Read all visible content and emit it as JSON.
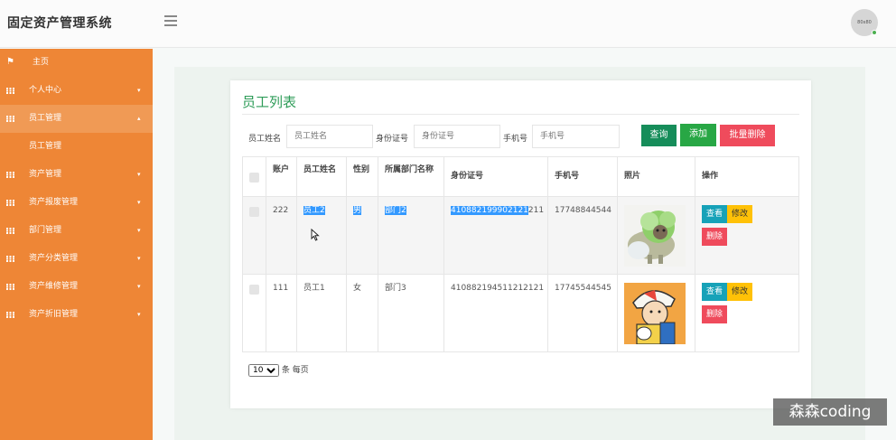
{
  "header": {
    "app_title": "固定资产管理系统",
    "avatar_text": "80x80"
  },
  "sidebar": {
    "items": [
      {
        "label": "主页",
        "icon": "flag-icon",
        "expanded": false
      },
      {
        "label": "个人中心",
        "icon": "grid-icon",
        "caret": "▾"
      },
      {
        "label": "员工管理",
        "icon": "grid-icon",
        "caret": "▴",
        "active": true
      },
      {
        "label": "资产管理",
        "icon": "grid-icon",
        "caret": "▾"
      },
      {
        "label": "资产报废管理",
        "icon": "grid-icon",
        "caret": "▾"
      },
      {
        "label": "部门管理",
        "icon": "grid-icon",
        "caret": "▾"
      },
      {
        "label": "资产分类管理",
        "icon": "grid-icon",
        "caret": "▾"
      },
      {
        "label": "资产维修管理",
        "icon": "grid-icon",
        "caret": "▾"
      },
      {
        "label": "资产折旧管理",
        "icon": "grid-icon",
        "caret": "▾"
      }
    ],
    "subitem": "员工管理"
  },
  "card": {
    "title": "员工列表",
    "filters": {
      "name_label": "员工姓名",
      "name_placeholder": "员工姓名",
      "id_label": "身份证号",
      "id_placeholder": "身份证号",
      "phone_label": "手机号",
      "phone_placeholder": "手机号"
    },
    "buttons": {
      "search": "查询",
      "add": "添加",
      "batch_delete": "批量删除"
    },
    "colors": {
      "search": "#168d5a",
      "add": "#28a745",
      "batch_delete": "#ef4b5c",
      "view": "#17a2b8",
      "edit": "#ffc107",
      "delete": "#ef4b5c"
    }
  },
  "table": {
    "headers": [
      "账户",
      "员工姓名",
      "性别",
      "所属部门名称",
      "身份证号",
      "手机号",
      "照片",
      "操作"
    ],
    "rows": [
      {
        "account": "222",
        "name": "员工2",
        "gender": "男",
        "dept": "部门2",
        "id_selected": "410882199902121",
        "id_rest": "211",
        "phone": "17748844544"
      },
      {
        "account": "111",
        "name": "员工1",
        "gender": "女",
        "dept": "部门3",
        "id_selected": "",
        "id_rest": "410882194511212121",
        "phone": "17745544545"
      }
    ],
    "actions": {
      "view": "查看",
      "edit": "修改",
      "delete": "删除"
    }
  },
  "pagination": {
    "page_size": "10",
    "options": [
      "10"
    ],
    "suffix": "条 每页"
  },
  "watermark": "森森coding"
}
